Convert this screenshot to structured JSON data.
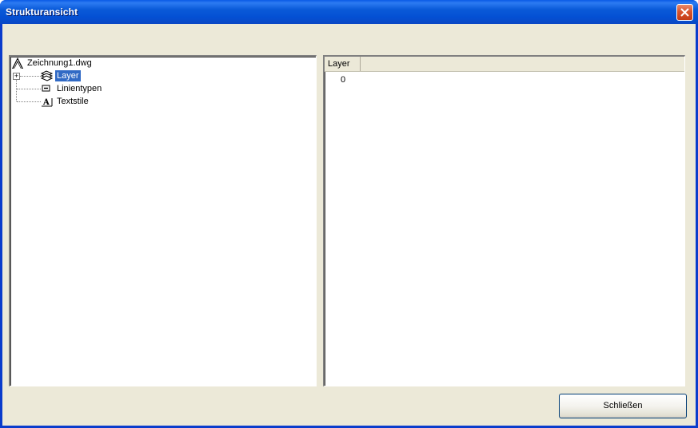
{
  "window": {
    "title": "Strukturansicht"
  },
  "tree": {
    "root": {
      "label": "Zeichnung1.dwg",
      "icon": "drawing-icon"
    },
    "items": [
      {
        "label": "Layer",
        "icon": "layers-icon",
        "expander": "+",
        "selected": true
      },
      {
        "label": "Linientypen",
        "icon": "linetype-icon",
        "expander": "",
        "selected": false
      },
      {
        "label": "Textstile",
        "icon": "textstyle-icon",
        "expander": "",
        "selected": false
      }
    ]
  },
  "list": {
    "columns": [
      "Layer"
    ],
    "rows": [
      [
        "0"
      ]
    ]
  },
  "buttons": {
    "close_label": "Schließen"
  },
  "colors": {
    "selection": "#316ac5",
    "titlebar": "#0a5ad8",
    "client": "#ece9d8"
  }
}
